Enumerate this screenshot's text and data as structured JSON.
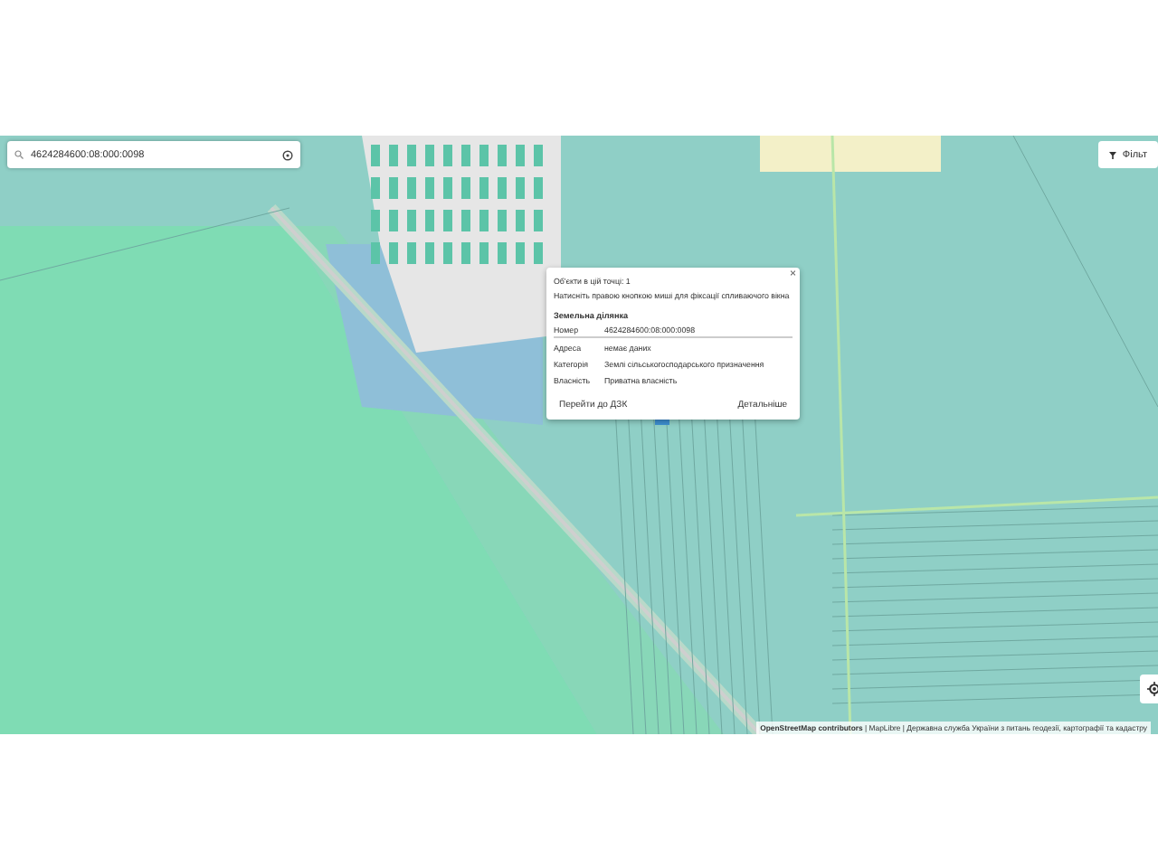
{
  "search": {
    "value": "4624284600:08:000:0098"
  },
  "filter_button": {
    "label": "Фільт"
  },
  "popup": {
    "title": "Об'єкти в цій точці: 1",
    "hint": "Натисніть правою кнопкою миші для фіксації спливаючого вікна",
    "close": "×",
    "section": "Земельна ділянка",
    "rows": [
      {
        "label": "Номер",
        "value": "4624284600:08:000:0098"
      },
      {
        "label": "Адреса",
        "value": "немає даних"
      },
      {
        "label": "Категорія",
        "value": "Землі сільськогосподарського призначення"
      },
      {
        "label": "Власність",
        "value": "Приватна власність"
      }
    ],
    "buttons": [
      "Перейти до ДЗК",
      "Детальніше"
    ]
  },
  "attribution": {
    "link": "OpenStreetMap contributors",
    "text": "| MapLibre | Державна служба України з питань геодезії, картографії та кадастру"
  }
}
